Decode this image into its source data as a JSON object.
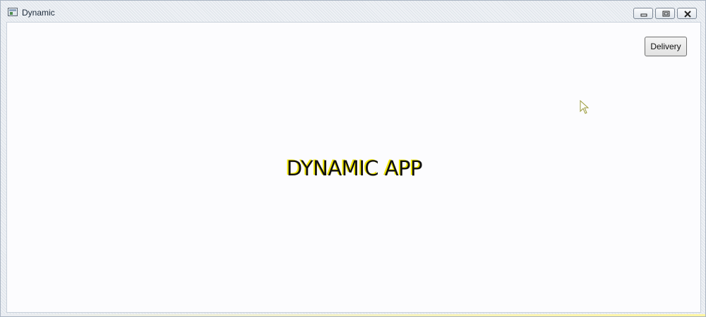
{
  "window": {
    "title": "Dynamic",
    "caption_buttons": [
      {
        "name": "minimize-button",
        "icon": "minimize-icon"
      },
      {
        "name": "maximize-button",
        "icon": "restore-icon"
      },
      {
        "name": "close-button",
        "icon": "close-icon"
      }
    ]
  },
  "main": {
    "delivery_button_label": "Delivery",
    "headline": "DYNAMIC APP"
  },
  "colors": {
    "headline_shadow": "#f2e600",
    "client_background": "#fcfcfe"
  }
}
